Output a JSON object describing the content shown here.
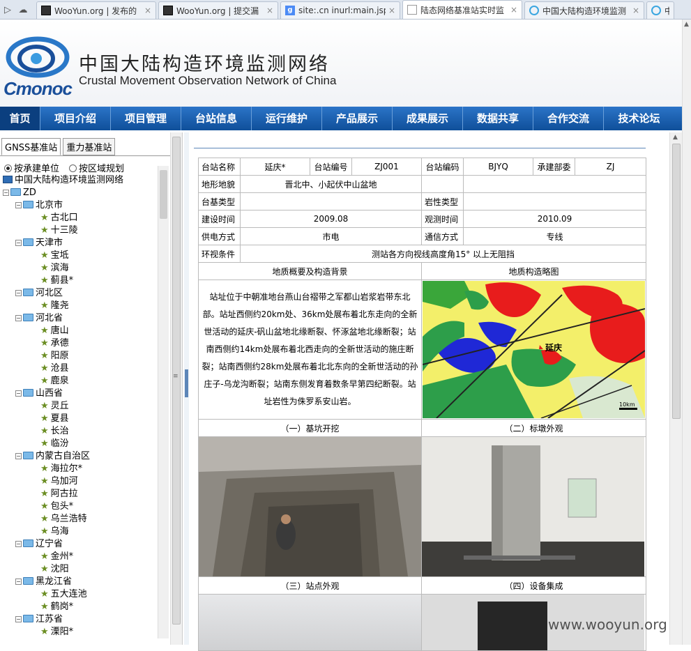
{
  "browser": {
    "tabs": [
      {
        "label": "WooYun.org | 发布的",
        "icon": "wooyun-icon",
        "active": false
      },
      {
        "label": "WooYun.org | 提交漏",
        "icon": "wooyun-icon",
        "active": false
      },
      {
        "label": "site:.cn inurl:main.jsp",
        "icon": "google-icon",
        "active": false
      },
      {
        "label": "陆态网络基准站实时监",
        "icon": "document-icon",
        "active": true
      },
      {
        "label": "中国大陆构造环境监测",
        "icon": "search-q-icon",
        "active": false
      },
      {
        "label": "中",
        "icon": "search-q-icon",
        "active": false
      }
    ]
  },
  "header": {
    "logo_text": "Cmonoc",
    "title_cn": "中国大陆构造环境监测网络",
    "title_en": "Crustal Movement Observation Network of China"
  },
  "nav": [
    "首页",
    "项目介绍",
    "项目管理",
    "台站信息",
    "运行维护",
    "产品展示",
    "成果展示",
    "数据共享",
    "合作交流",
    "技术论坛"
  ],
  "sidebar": {
    "tabs": [
      "GNSS基准站",
      "重力基准站"
    ],
    "radios": [
      {
        "label": "按承建单位",
        "checked": true
      },
      {
        "label": "按区域规划",
        "checked": false
      }
    ],
    "tree": [
      {
        "level": 0,
        "type": "root",
        "label": "中国大陆构造环境监测网络"
      },
      {
        "level": 0,
        "type": "folder",
        "label": "ZD"
      },
      {
        "level": 1,
        "type": "folder",
        "label": "北京市"
      },
      {
        "level": 2,
        "type": "station",
        "label": "古北口"
      },
      {
        "level": 2,
        "type": "station",
        "label": "十三陵"
      },
      {
        "level": 1,
        "type": "folder",
        "label": "天津市"
      },
      {
        "level": 2,
        "type": "station",
        "label": "宝坻"
      },
      {
        "level": 2,
        "type": "station",
        "label": "滨海"
      },
      {
        "level": 2,
        "type": "station",
        "label": "蓟县*"
      },
      {
        "level": 1,
        "type": "folder",
        "label": "河北区"
      },
      {
        "level": 2,
        "type": "station",
        "label": "隆尧"
      },
      {
        "level": 1,
        "type": "folder",
        "label": "河北省"
      },
      {
        "level": 2,
        "type": "station",
        "label": "唐山"
      },
      {
        "level": 2,
        "type": "station",
        "label": "承德"
      },
      {
        "level": 2,
        "type": "station",
        "label": "阳原"
      },
      {
        "level": 2,
        "type": "station",
        "label": "沧县"
      },
      {
        "level": 2,
        "type": "station",
        "label": "鹿泉"
      },
      {
        "level": 1,
        "type": "folder",
        "label": "山西省"
      },
      {
        "level": 2,
        "type": "station",
        "label": "灵丘"
      },
      {
        "level": 2,
        "type": "station",
        "label": "夏县"
      },
      {
        "level": 2,
        "type": "station",
        "label": "长治"
      },
      {
        "level": 2,
        "type": "station",
        "label": "临汾"
      },
      {
        "level": 1,
        "type": "folder",
        "label": "内蒙古自治区"
      },
      {
        "level": 2,
        "type": "station",
        "label": "海拉尔*"
      },
      {
        "level": 2,
        "type": "station",
        "label": "乌加河"
      },
      {
        "level": 2,
        "type": "station",
        "label": "阿古拉"
      },
      {
        "level": 2,
        "type": "station",
        "label": "包头*"
      },
      {
        "level": 2,
        "type": "station",
        "label": "乌兰浩特"
      },
      {
        "level": 2,
        "type": "station",
        "label": "乌海"
      },
      {
        "level": 1,
        "type": "folder",
        "label": "辽宁省"
      },
      {
        "level": 2,
        "type": "station",
        "label": "金州*"
      },
      {
        "level": 2,
        "type": "station",
        "label": "沈阳"
      },
      {
        "level": 1,
        "type": "folder",
        "label": "黑龙江省"
      },
      {
        "level": 2,
        "type": "station",
        "label": "五大连池"
      },
      {
        "level": 2,
        "type": "station",
        "label": "鹤岗*"
      },
      {
        "level": 1,
        "type": "folder",
        "label": "江苏省"
      },
      {
        "level": 2,
        "type": "station",
        "label": "溧阳*"
      }
    ]
  },
  "station": {
    "name_label": "台站名称",
    "name": "延庆*",
    "no_label": "台站编号",
    "no": "ZJ001",
    "code_label": "台站编码",
    "code": "BJYQ",
    "dept_label": "承建部委",
    "dept": "ZJ",
    "terrain_label": "地形地貌",
    "terrain": "晋北中、小起伏中山盆地",
    "base_label": "台基类型",
    "base": "",
    "rock_label": "岩性类型",
    "rock": "",
    "build_label": "建设时间",
    "build": "2009.08",
    "obs_label": "观测时间",
    "obs": "2010.09",
    "power_label": "供电方式",
    "power": "市电",
    "comm_label": "通信方式",
    "comm": "专线",
    "view_label": "环视条件",
    "view": "测站各方向视线高度角15° 以上无阻挡",
    "geo_title": "地质概要及构造背景",
    "map_title": "地质构造略图",
    "geo_text": "站址位于中朝准地台燕山台褶带之军都山岩浆岩带东北部。站址西侧约20km处、36km处展布着北东走向的全新世活动的延庆-矾山盆地北缘断裂、怀涿盆地北缘断裂；站南西侧约14km处展布着北西走向的全新世活动的施庄断裂；站南西侧约28km处展布着北北东向的全新世活动的孙庄子-乌龙沟断裂；站南东侧发育着数条早第四纪断裂。站址岩性为侏罗系安山岩。",
    "map_label": "延庆",
    "map_scale": "10km",
    "cap1": "（一）基坑开挖",
    "cap2": "（二）标墩外观",
    "cap3": "（三）站点外观",
    "cap4": "（四）设备集成"
  },
  "watermark": "www.wooyun.org"
}
